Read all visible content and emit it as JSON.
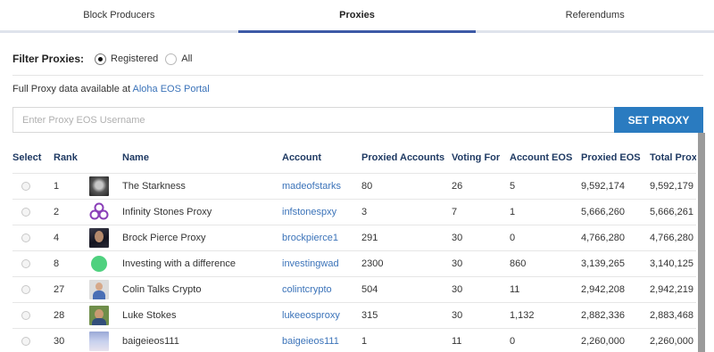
{
  "tabs": [
    "Block Producers",
    "Proxies",
    "Referendums"
  ],
  "active_tab": "Proxies",
  "filter": {
    "label": "Filter Proxies:",
    "options": [
      {
        "label": "Registered",
        "checked": true
      },
      {
        "label": "All",
        "checked": false
      }
    ]
  },
  "portal": {
    "text": "Full Proxy data available at",
    "link_text": "Aloha EOS Portal"
  },
  "search": {
    "placeholder": "Enter Proxy EOS Username",
    "value": "",
    "button_label": "SET PROXY"
  },
  "colors": {
    "accent": "#3d5aa6",
    "button": "#2a7bc0",
    "link": "#3b73b9",
    "header_text": "#1f3a63"
  },
  "table": {
    "columns": [
      "Select",
      "Rank",
      "",
      "Name",
      "Account",
      "Proxied Accounts",
      "Voting For",
      "Account EOS",
      "Proxied EOS",
      "Total Proxy"
    ],
    "rows": [
      {
        "rank": "1",
        "avatar": "starkness-avatar",
        "name": "The Starkness",
        "account": "madeofstarks",
        "proxied_accounts": "80",
        "voting_for": "26",
        "account_eos": "5",
        "proxied_eos": "9,592,174",
        "total_proxy": "9,592,179"
      },
      {
        "rank": "2",
        "avatar": "infinity-knot-avatar",
        "name": "Infinity Stones Proxy",
        "account": "infstonespxy",
        "proxied_accounts": "3",
        "voting_for": "7",
        "account_eos": "1",
        "proxied_eos": "5,666,260",
        "total_proxy": "5,666,261"
      },
      {
        "rank": "4",
        "avatar": "brock-photo-avatar",
        "name": "Brock Pierce Proxy",
        "account": "brockpierce1",
        "proxied_accounts": "291",
        "voting_for": "30",
        "account_eos": "0",
        "proxied_eos": "4,766,280",
        "total_proxy": "4,766,280"
      },
      {
        "rank": "8",
        "avatar": "green-circle-avatar",
        "name": "Investing with a difference",
        "account": "investingwad",
        "proxied_accounts": "2300",
        "voting_for": "30",
        "account_eos": "860",
        "proxied_eos": "3,139,265",
        "total_proxy": "3,140,125"
      },
      {
        "rank": "27",
        "avatar": "colin-photo-avatar",
        "name": "Colin Talks Crypto",
        "account": "colintcrypto",
        "proxied_accounts": "504",
        "voting_for": "30",
        "account_eos": "11",
        "proxied_eos": "2,942,208",
        "total_proxy": "2,942,219"
      },
      {
        "rank": "28",
        "avatar": "luke-photo-avatar",
        "name": "Luke Stokes",
        "account": "lukeeosproxy",
        "proxied_accounts": "315",
        "voting_for": "30",
        "account_eos": "1,132",
        "proxied_eos": "2,882,336",
        "total_proxy": "2,883,468"
      },
      {
        "rank": "30",
        "avatar": "baige-photo-avatar",
        "name": "baigeieos111",
        "account": "baigeieos111",
        "proxied_accounts": "1",
        "voting_for": "11",
        "account_eos": "0",
        "proxied_eos": "2,260,000",
        "total_proxy": "2,260,000"
      }
    ]
  }
}
